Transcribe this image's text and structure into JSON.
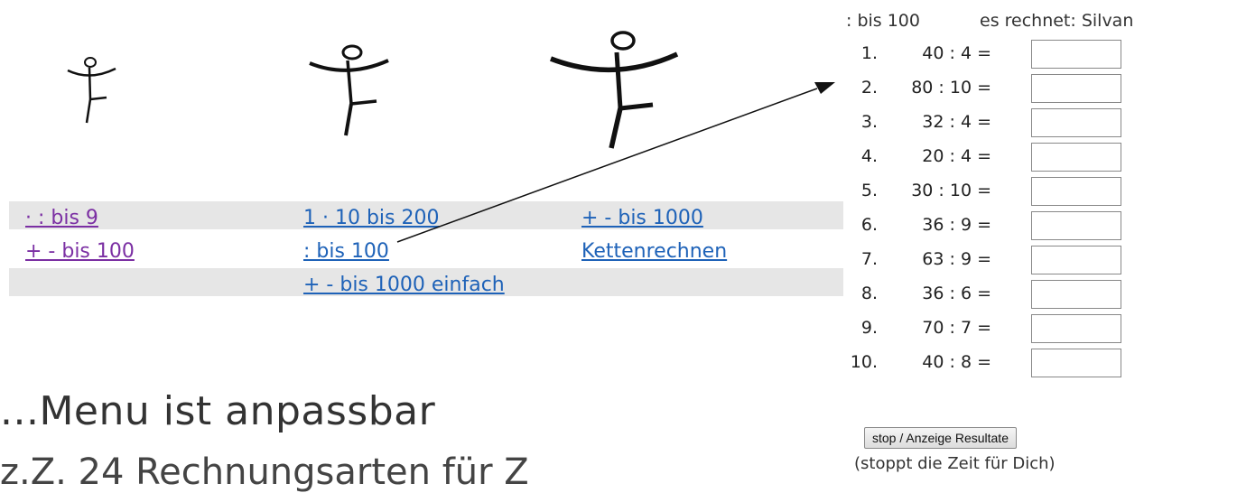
{
  "menu": {
    "rows": [
      [
        "· : bis 9",
        "1 · 10 bis 200",
        "+ - bis 1000"
      ],
      [
        "+ - bis 100",
        ": bis 100",
        "Kettenrechnen"
      ],
      [
        "",
        "+ - bis 1000 einfach",
        ""
      ]
    ]
  },
  "heading": "...Menu ist anpassbar",
  "subline": "z.Z. 24 Rechnungsarten für Z",
  "quiz": {
    "title": ": bis 100",
    "user": "es rechnet: Silvan",
    "items": [
      {
        "num": "1.",
        "expr": "40 : 4 ="
      },
      {
        "num": "2.",
        "expr": "80 : 10 ="
      },
      {
        "num": "3.",
        "expr": "32 : 4 ="
      },
      {
        "num": "4.",
        "expr": "20 : 4 ="
      },
      {
        "num": "5.",
        "expr": "30 : 10 ="
      },
      {
        "num": "6.",
        "expr": "36 : 9 ="
      },
      {
        "num": "7.",
        "expr": "63 : 9 ="
      },
      {
        "num": "8.",
        "expr": "36 : 6 ="
      },
      {
        "num": "9.",
        "expr": "70 : 7 ="
      },
      {
        "num": "10.",
        "expr": "40 : 8 ="
      }
    ],
    "stop_label": "stop / Anzeige Resultate",
    "stop_note": "(stoppt die Zeit für Dich)"
  }
}
